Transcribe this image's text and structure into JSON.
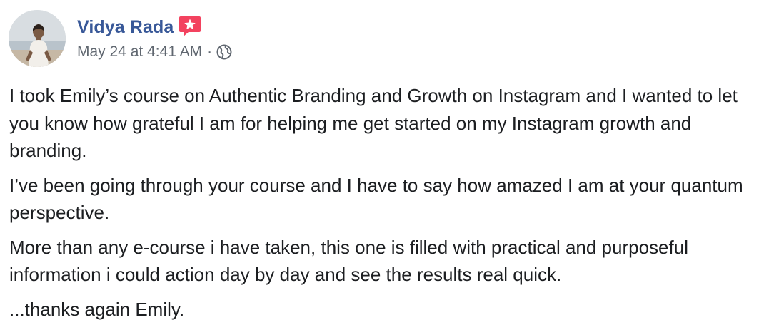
{
  "post": {
    "author": {
      "name": "Vidya Rada",
      "avatar_icon": "profile-photo",
      "badge_icon": "star-badge-icon",
      "badge_color": "#f3425f"
    },
    "timestamp": "May 24 at 4:41 AM",
    "separator": "·",
    "privacy_icon": "globe-icon",
    "paragraphs": [
      "I took Emily’s course on Authentic Branding and Growth on Instagram and I wanted to let you know how grateful I am for helping me get started on my Instagram growth and branding.",
      "I’ve been going through your course and I have to say how amazed I am at your quantum perspective.",
      "More than any e-course i have taken, this one is filled with practical and purposeful information i could action day by day and see the results real quick.",
      "...thanks again Emily."
    ]
  },
  "colors": {
    "name_link": "#385898",
    "meta_text": "#606770",
    "body_text": "#1c1e21"
  }
}
